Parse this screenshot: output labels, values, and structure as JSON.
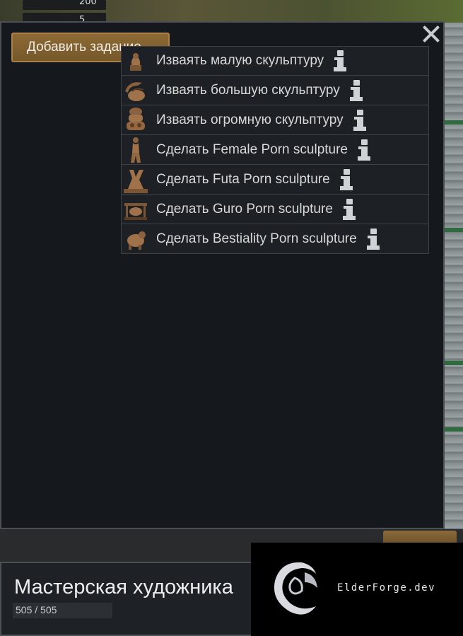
{
  "top_resources": [
    {
      "value": "200",
      "icon": "resource-icon"
    },
    {
      "value": "5",
      "icon": "stone-chunk-icon"
    }
  ],
  "dialog": {
    "add_bill_label": "Добавить задание",
    "close_icon": "close-icon"
  },
  "menu": {
    "items": [
      {
        "label": "Изваять малую скульптуру",
        "icon": "small-sculpture-icon"
      },
      {
        "label": "Изваять большую скульптуру",
        "icon": "large-sculpture-icon"
      },
      {
        "label": "Изваять огромную скульптуру",
        "icon": "grand-sculpture-icon"
      },
      {
        "label": "Сделать Female Porn sculpture",
        "icon": "female-sculpture-icon"
      },
      {
        "label": "Сделать Futa Porn sculpture",
        "icon": "futa-sculpture-icon"
      },
      {
        "label": "Сделать Guro Porn sculpture",
        "icon": "guro-sculpture-icon"
      },
      {
        "label": "Сделать Bestiality Porn sculpture",
        "icon": "bestiality-sculpture-icon"
      }
    ],
    "info_icon": "info-icon"
  },
  "inspect": {
    "title": "Мастерская художника",
    "hit_points": "505 / 505"
  },
  "watermark": {
    "text": "ElderForge.dev"
  },
  "colors": {
    "panel_bg": "#15181c",
    "button_brown": "#8d6a35",
    "text_light": "#d6d8d9",
    "sculpture_bronze": "#a0724a"
  }
}
